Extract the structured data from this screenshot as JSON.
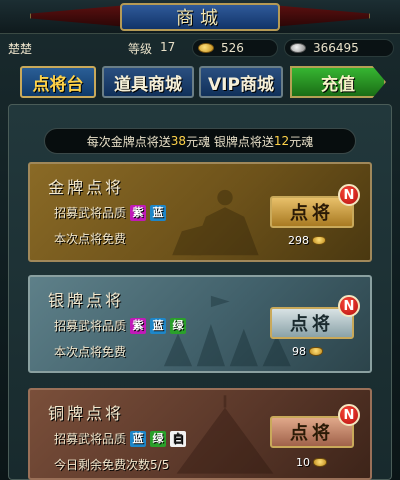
{
  "header": {
    "title": "商城"
  },
  "status": {
    "player_name": "楚楚",
    "level_label": "等级",
    "level": "17",
    "gold": "526",
    "silver": "366495"
  },
  "tabs": [
    {
      "label": "点将台",
      "active": true
    },
    {
      "label": "道具商城",
      "active": false
    },
    {
      "label": "VIP商城",
      "active": false
    }
  ],
  "recharge_label": "充值",
  "info": {
    "prefix": "每次金牌点将送",
    "gold_amount": "38",
    "middle": "元魂 银牌点将送",
    "silver_amount": "12",
    "suffix": "元魂"
  },
  "cards": {
    "gold": {
      "title": "金牌点将",
      "quality_label": "招募武将品质",
      "qualities": [
        "紫",
        "蓝"
      ],
      "note": "本次点将免费",
      "button": "点将",
      "badge": "N",
      "cost": "298"
    },
    "silver": {
      "title": "银牌点将",
      "quality_label": "招募武将品质",
      "qualities": [
        "紫",
        "蓝",
        "绿"
      ],
      "note": "本次点将免费",
      "button": "点将",
      "badge": "N",
      "cost": "98"
    },
    "bronze": {
      "title": "铜牌点将",
      "quality_label": "招募武将品质",
      "qualities": [
        "蓝",
        "绿",
        "白"
      ],
      "note": "今日剩余免费次数",
      "note_count": "5/5",
      "button": "点将",
      "badge": "N",
      "cost": "10"
    }
  },
  "colors": {
    "accent_gold_text": "#ffd34a",
    "quality_purple": "#c01ab8",
    "quality_blue": "#1e86c8",
    "quality_green": "#2aa02a",
    "quality_white": "#f2f2f2",
    "recharge_green": "#36b532"
  }
}
